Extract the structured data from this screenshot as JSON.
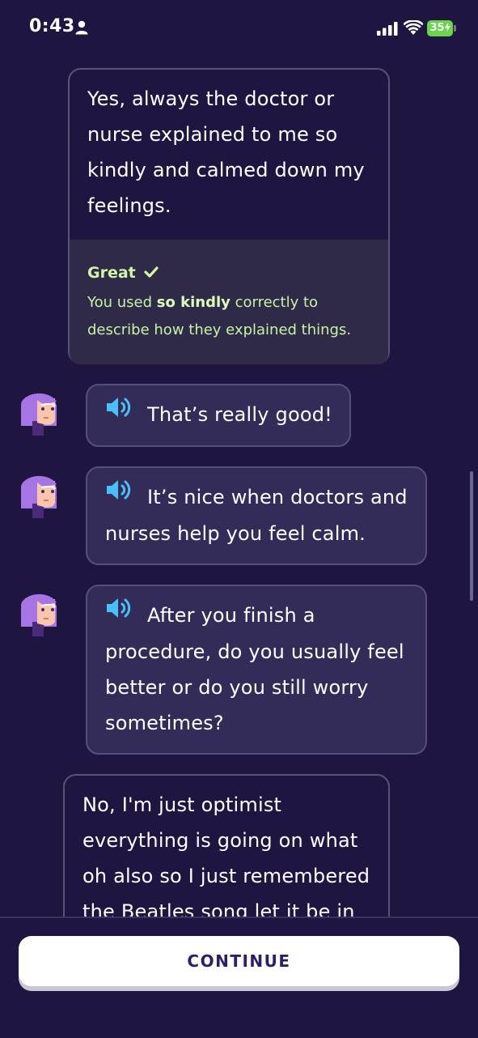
{
  "status": {
    "time": "0:43",
    "battery": "35"
  },
  "messages": [
    {
      "role": "user",
      "text": "Yes, always the doctor or nurse explained to me so kindly and calmed down my feelings.",
      "feedback": {
        "title": "Great",
        "before": "You used ",
        "highlight": "so kindly",
        "after": " correctly to describe how they explained things."
      }
    },
    {
      "role": "bot",
      "text": "That’s really good!"
    },
    {
      "role": "bot",
      "text": "It’s nice when doctors and nurses help you feel calm."
    },
    {
      "role": "bot",
      "text": "After you finish a procedure, do you usually feel better or do you still worry sometimes?"
    },
    {
      "role": "user",
      "text": "No, I'm just optimist everything is going on what oh also so I just remembered the Beatles song let it be in"
    }
  ],
  "footer": {
    "continue_label": "CONTINUE"
  },
  "colors": {
    "background": "#1e1640",
    "feedback_text": "#c9f2a4",
    "button_text": "#2a1f6b"
  }
}
